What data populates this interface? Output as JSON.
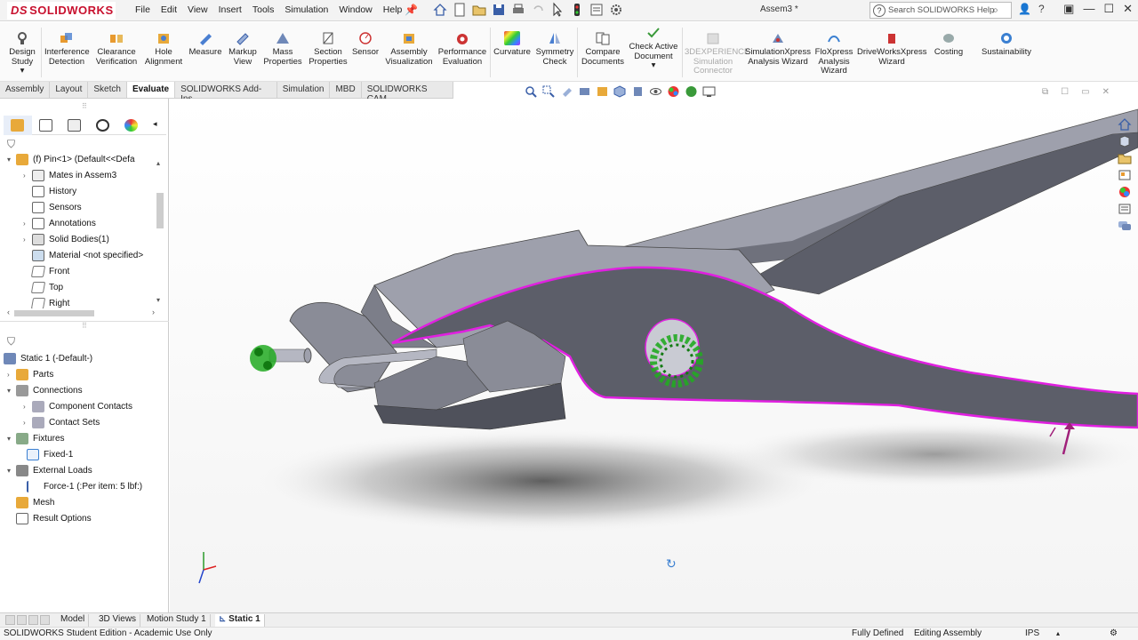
{
  "app": {
    "brand": "SOLIDWORKS",
    "brand_prefix": "DS",
    "document_title": "Assem3 *"
  },
  "menu": [
    "File",
    "Edit",
    "View",
    "Insert",
    "Tools",
    "Simulation",
    "Window",
    "Help"
  ],
  "search": {
    "placeholder": "Search SOLIDWORKS Help"
  },
  "ribbon": {
    "items": [
      {
        "label1": "Design",
        "label2": "Study",
        "icon": "design-study-icon"
      },
      {
        "label1": "Interference",
        "label2": "Detection",
        "icon": "interference-icon"
      },
      {
        "label1": "Clearance",
        "label2": "Verification",
        "icon": "clearance-icon"
      },
      {
        "label1": "Hole",
        "label2": "Alignment",
        "icon": "hole-alignment-icon"
      },
      {
        "label1": "Measure",
        "label2": "",
        "icon": "measure-icon"
      },
      {
        "label1": "Markup",
        "label2": "View",
        "icon": "markup-icon"
      },
      {
        "label1": "Mass",
        "label2": "Properties",
        "icon": "mass-properties-icon"
      },
      {
        "label1": "Section",
        "label2": "Properties",
        "icon": "section-properties-icon"
      },
      {
        "label1": "Sensor",
        "label2": "",
        "icon": "sensor-icon"
      },
      {
        "label1": "Assembly",
        "label2": "Visualization",
        "icon": "assembly-visualization-icon"
      },
      {
        "label1": "Performance",
        "label2": "Evaluation",
        "icon": "performance-icon"
      },
      {
        "label1": "Curvature",
        "label2": "",
        "icon": "curvature-icon"
      },
      {
        "label1": "Symmetry",
        "label2": "Check",
        "icon": "symmetry-icon"
      },
      {
        "label1": "Compare",
        "label2": "Documents",
        "icon": "compare-icon"
      },
      {
        "label1": "Check Active",
        "label2": "Document",
        "icon": "check-active-icon"
      },
      {
        "label1": "3DEXPERIENCE",
        "label2": "Simulation",
        "label3": "Connector",
        "icon": "3dx-icon"
      },
      {
        "label1": "SimulationXpress",
        "label2": "Analysis Wizard",
        "icon": "simxpress-icon"
      },
      {
        "label1": "FloXpress",
        "label2": "Analysis",
        "label3": "Wizard",
        "icon": "floxpress-icon"
      },
      {
        "label1": "DriveWorksXpress",
        "label2": "Wizard",
        "icon": "driveworks-icon"
      },
      {
        "label1": "Costing",
        "label2": "",
        "icon": "costing-icon"
      },
      {
        "label1": "Sustainability",
        "label2": "",
        "icon": "sustainability-icon"
      }
    ]
  },
  "tabs": [
    "Assembly",
    "Layout",
    "Sketch",
    "Evaluate",
    "SOLIDWORKS Add-Ins",
    "Simulation",
    "MBD",
    "SOLIDWORKS CAM"
  ],
  "active_tab": "Evaluate",
  "feature_tree": [
    {
      "label": "(f) Pin<1> (Default<<Defa",
      "arrow": "▾",
      "icon": "part-icon"
    },
    {
      "label": "Mates in Assem3",
      "arrow": "›",
      "icon": "mates-icon"
    },
    {
      "label": "History",
      "arrow": "",
      "icon": "history-icon"
    },
    {
      "label": "Sensors",
      "arrow": "",
      "icon": "sensors-icon"
    },
    {
      "label": "Annotations",
      "arrow": "›",
      "icon": "annotations-icon"
    },
    {
      "label": "Solid Bodies(1)",
      "arrow": "›",
      "icon": "solid-bodies-icon"
    },
    {
      "label": "Material <not specified>",
      "arrow": "",
      "icon": "material-icon"
    },
    {
      "label": "Front",
      "arrow": "",
      "icon": "plane-icon"
    },
    {
      "label": "Top",
      "arrow": "",
      "icon": "plane-icon"
    },
    {
      "label": "Right",
      "arrow": "",
      "icon": "plane-icon"
    }
  ],
  "sim_tree": [
    {
      "label": "Static 1 (-Default-)",
      "arrow": "",
      "icon": "study-icon"
    },
    {
      "label": "Parts",
      "arrow": "›",
      "icon": "parts-icon"
    },
    {
      "label": "Connections",
      "arrow": "▾",
      "icon": "connections-icon"
    },
    {
      "label": "Component Contacts",
      "arrow": "›",
      "icon": "component-contacts-icon"
    },
    {
      "label": "Contact Sets",
      "arrow": "›",
      "icon": "contact-sets-icon"
    },
    {
      "label": "Fixtures",
      "arrow": "▾",
      "icon": "fixtures-icon"
    },
    {
      "label": "Fixed-1",
      "arrow": "",
      "icon": "fixed-icon"
    },
    {
      "label": "External Loads",
      "arrow": "▾",
      "icon": "external-loads-icon"
    },
    {
      "label": "Force-1 (:Per item: 5 lbf:)",
      "arrow": "",
      "icon": "force-icon"
    },
    {
      "label": "Mesh",
      "arrow": "",
      "icon": "mesh-icon"
    },
    {
      "label": "Result Options",
      "arrow": "",
      "icon": "result-options-icon"
    }
  ],
  "bottom_tabs": [
    "Model",
    "3D Views",
    "Motion Study 1",
    "Static 1"
  ],
  "active_bottom_tab": "Static 1",
  "status": {
    "edition": "SOLIDWORKS Student Edition - Academic Use Only",
    "definition": "Fully Defined",
    "mode": "Editing Assembly",
    "units": "IPS"
  },
  "colors": {
    "accent_red": "#c8102e",
    "selection_magenta": "#e020e0",
    "fixture_green": "#22aa22",
    "part_gray": "#6f717c",
    "part_light": "#9ea0ac"
  }
}
